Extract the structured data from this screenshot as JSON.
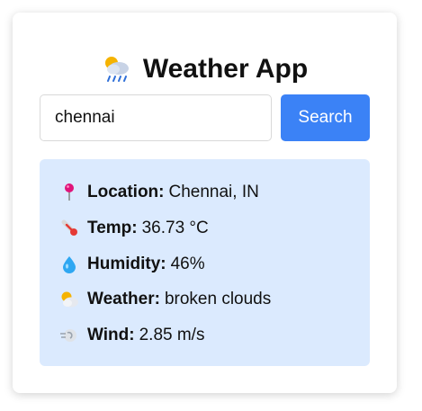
{
  "app": {
    "title": "Weather App",
    "title_icon": "cloud-rain-sun-icon"
  },
  "search": {
    "value": "chennai",
    "button_label": "Search"
  },
  "result": {
    "rows": [
      {
        "icon": "pin-icon",
        "label": "Location:",
        "value": "Chennai, IN"
      },
      {
        "icon": "thermometer-icon",
        "label": "Temp:",
        "value": "36.73 °C"
      },
      {
        "icon": "droplet-icon",
        "label": "Humidity:",
        "value": "46%"
      },
      {
        "icon": "sun-behind-cloud-icon",
        "label": "Weather:",
        "value": "broken clouds"
      },
      {
        "icon": "wind-icon",
        "label": "Wind:",
        "value": "2.85 m/s"
      }
    ]
  },
  "colors": {
    "accent": "#3b82f6",
    "panel_background": "#dbeafe"
  }
}
